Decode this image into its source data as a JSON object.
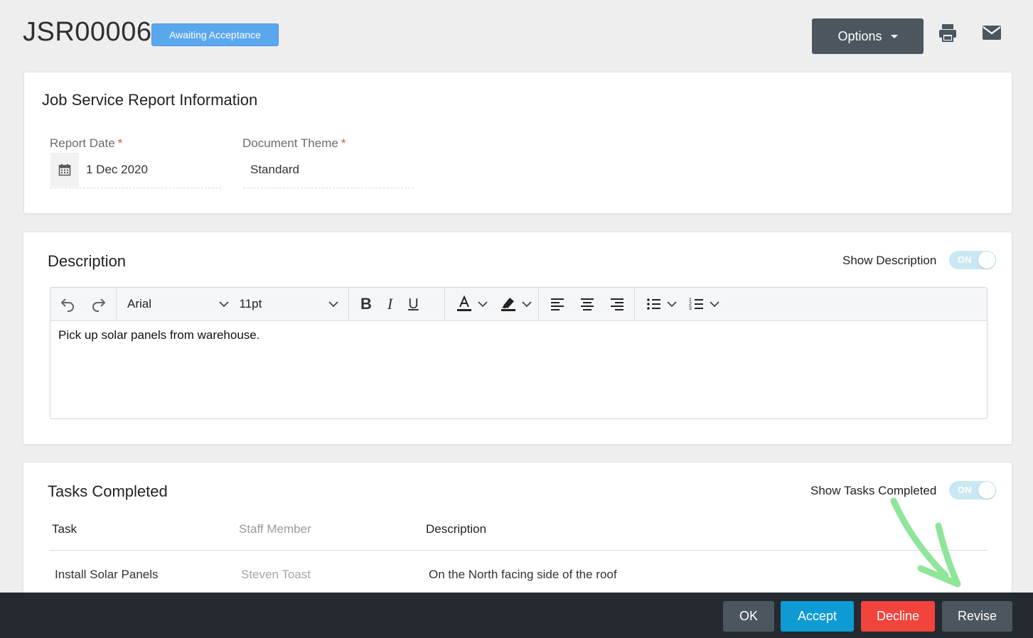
{
  "header": {
    "job_id": "JSR00006",
    "status": "Awaiting Acceptance",
    "options_label": "Options"
  },
  "info_card": {
    "title": "Job Service Report Information",
    "report_date_label": "Report Date",
    "report_date_value": "1 Dec 2020",
    "theme_label": "Document Theme",
    "theme_value": "Standard",
    "required_mark": "*"
  },
  "description_card": {
    "title": "Description",
    "toggle_label": "Show Description",
    "toggle_state": "ON",
    "font_family": "Arial",
    "font_size": "11pt",
    "body": "Pick up solar panels from warehouse."
  },
  "tasks_card": {
    "title": "Tasks Completed",
    "toggle_label": "Show Tasks Completed",
    "toggle_state": "ON",
    "columns": [
      "Task",
      "Staff Member",
      "Description"
    ],
    "rows": [
      [
        "Install Solar Panels",
        "Steven Toast",
        "On the North facing side of the roof"
      ]
    ]
  },
  "actions": {
    "ok": "OK",
    "accept": "Accept",
    "decline": "Decline",
    "revise": "Revise"
  },
  "colors": {
    "status_badge": "#5aa7ee",
    "ok": "#4c565f",
    "accept": "#0e9bd3",
    "decline": "#f0443c",
    "revise": "#4c565f",
    "annotation_arrow": "#8fe59a"
  },
  "icons": [
    "print-icon",
    "mail-icon",
    "calendar-icon",
    "undo-icon",
    "redo-icon",
    "bold-icon",
    "italic-icon",
    "underline-icon",
    "text-color-icon",
    "highlight-icon",
    "align-left-icon",
    "align-center-icon",
    "align-right-icon",
    "bullet-list-icon",
    "numbered-list-icon"
  ]
}
